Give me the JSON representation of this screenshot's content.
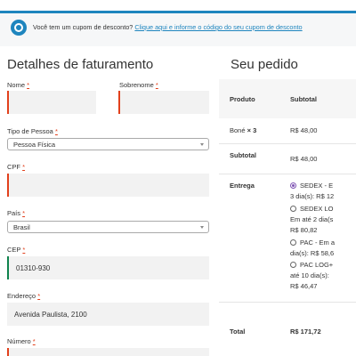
{
  "notice": {
    "icon": "info-icon",
    "text": "Você tem um cupom de desconto?",
    "link": "Clique aqui e informe o código do seu cupom de desconto",
    "color": "#1e85be"
  },
  "billing": {
    "heading": "Detalhes de faturamento",
    "required_mark": "*",
    "fields": {
      "nome": {
        "label": "Nome",
        "value": ""
      },
      "sobrenome": {
        "label": "Sobrenome",
        "value": ""
      },
      "tipo_pessoa": {
        "label": "Tipo de Pessoa",
        "value": "Pessoa Física"
      },
      "cpf": {
        "label": "CPF",
        "value": ""
      },
      "pais": {
        "label": "País",
        "value": "Brasil"
      },
      "cep": {
        "label": "CEP",
        "value": "01310-930"
      },
      "endereco": {
        "label": "Endereço",
        "value": "Avenida Paulista, 2100"
      },
      "numero": {
        "label": "Número",
        "value": ""
      }
    }
  },
  "order": {
    "heading": "Seu pedido",
    "col_product": "Produto",
    "col_subtotal": "Subtotal",
    "item_name": "Boné",
    "item_qty": "× 3",
    "item_subtotal": "R$ 48,00",
    "subtotal_label": "Subtotal",
    "subtotal_value": "R$ 48,00",
    "shipping_label": "Entrega",
    "shipping_options": [
      {
        "line1": "SEDEX - E",
        "line2": "3 dia(s): R$ 12",
        "selected": true
      },
      {
        "line1": "SEDEX LO",
        "line2": "Em até 2 dia(s",
        "line3": "R$ 80,82",
        "selected": false
      },
      {
        "line1": "PAC - Em a",
        "line2": "dia(s): R$ 58,6",
        "selected": false
      },
      {
        "line1": "PAC LOG+",
        "line2": "até 10 dia(s):",
        "line3": "R$ 46,47",
        "selected": false
      }
    ],
    "total_label": "Total",
    "total_value": "R$ 171,72"
  }
}
